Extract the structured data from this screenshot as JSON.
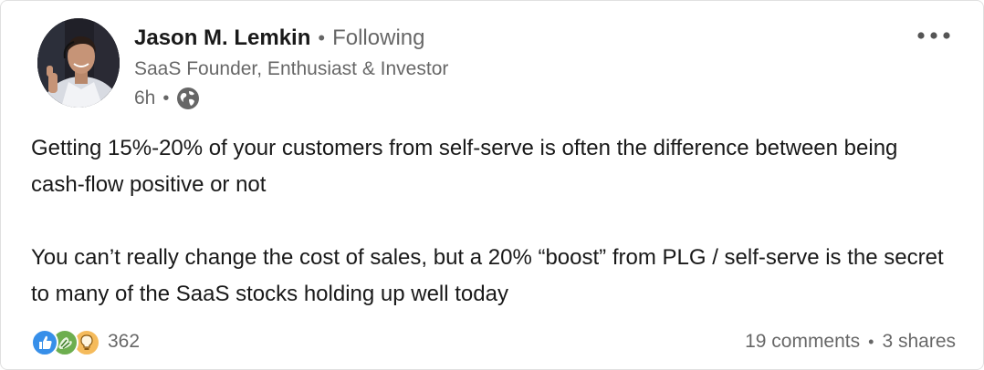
{
  "post": {
    "author": {
      "name": "Jason M. Lemkin",
      "follow_status": "Following",
      "headline": "SaaS Founder, Enthusiast & Investor",
      "time": "6h",
      "visibility_icon": "globe-icon"
    },
    "more_icon": "more-options-icon",
    "paragraphs": [
      "Getting 15%-20% of your customers from self-serve is often the difference between being cash-flow positive or not",
      "You can’t really change the cost of sales, but a 20% “boost” from PLG / self-serve is the secret to many of the SaaS stocks holding up well today"
    ],
    "reactions": {
      "icons": [
        "like-icon",
        "celebrate-icon",
        "insightful-icon"
      ],
      "count": "362"
    },
    "social": {
      "comments": "19 comments",
      "separator": "•",
      "shares": "3 shares"
    }
  },
  "colors": {
    "like": "#378fe9",
    "celebrate": "#6dae4f",
    "insightful": "#f5bb5c",
    "secondary_text": "#666666"
  }
}
